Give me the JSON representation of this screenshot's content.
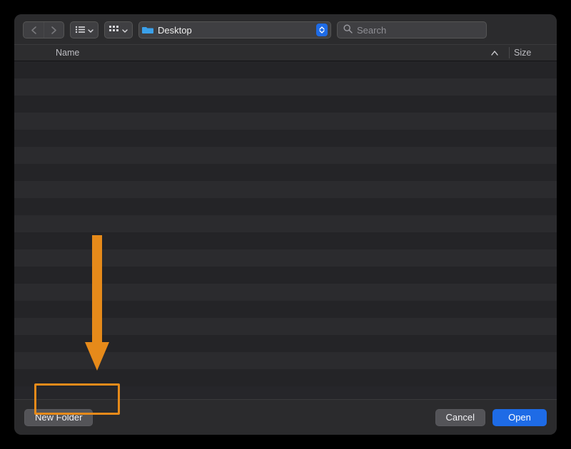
{
  "toolbar": {
    "location_label": "Desktop",
    "search_placeholder": "Search"
  },
  "columns": {
    "name": "Name",
    "size": "Size"
  },
  "footer": {
    "new_folder": "New Folder",
    "cancel": "Cancel",
    "open": "Open"
  },
  "colors": {
    "accent": "#1e6be6",
    "annotation": "#e68a1a"
  },
  "file_rows": []
}
